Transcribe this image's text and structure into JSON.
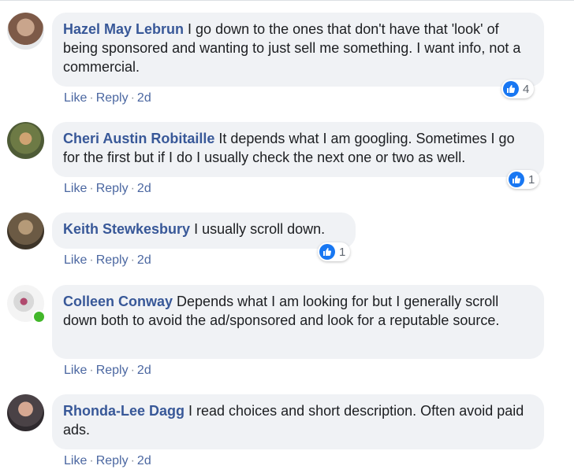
{
  "comments": [
    {
      "author": "Hazel May Lebrun",
      "text": " I go down to the ones that don't have that 'look' of being sponsored and wanting to just sell me something. I want info, not a commercial.",
      "like": "Like",
      "reply": "Reply",
      "time": "2d",
      "reactions": "4",
      "avatar_icon": "avatar-photo"
    },
    {
      "author": "Cheri Austin Robitaille",
      "text": " It depends what I am googling. Sometimes I go for the first but if I do I usually check the next one or two as well.",
      "like": "Like",
      "reply": "Reply",
      "time": "2d",
      "reactions": "1",
      "avatar_icon": "avatar-photo"
    },
    {
      "author": "Keith Stewkesbury",
      "text": " I usually scroll down.",
      "like": "Like",
      "reply": "Reply",
      "time": "2d",
      "reactions": "1",
      "avatar_icon": "avatar-photo"
    },
    {
      "author": "Colleen Conway",
      "text": " Depends what I am looking for but I generally scroll down both to avoid the ad/sponsored and look for a reputable source.",
      "like": "Like",
      "reply": "Reply",
      "time": "2d",
      "online": true,
      "avatar_icon": "avatar-photo"
    },
    {
      "author": "Rhonda-Lee Dagg",
      "text": " I read choices and short description. Often avoid paid ads.",
      "like": "Like",
      "reply": "Reply",
      "time": "2d",
      "avatar_icon": "avatar-photo"
    }
  ],
  "separator": "·",
  "colors": {
    "author": "#385898",
    "bubble": "#f0f2f5",
    "like_blue": "#1877f2",
    "online_green": "#42b72a"
  }
}
